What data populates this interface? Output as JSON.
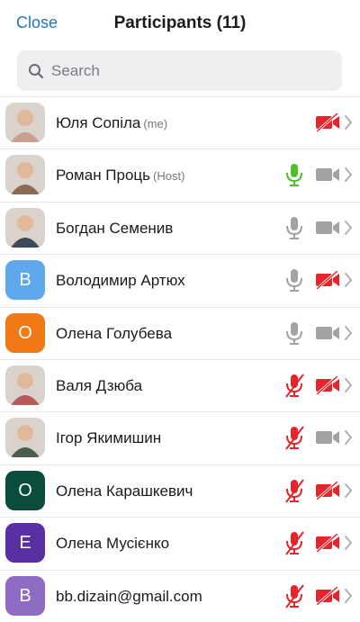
{
  "header": {
    "close_label": "Close",
    "title": "Participants (11)"
  },
  "search": {
    "placeholder": "Search"
  },
  "participants": [
    {
      "name": "Юля Сопіла",
      "tag": "(me)",
      "avatar_type": "photo",
      "avatar_color": "#c9a090",
      "mic": "none",
      "video": "off"
    },
    {
      "name": "Роман Проць",
      "tag": "(Host)",
      "avatar_type": "photo",
      "avatar_color": "#8b6b52",
      "mic": "active",
      "video": "on"
    },
    {
      "name": "Богдан Семенив",
      "tag": "",
      "avatar_type": "photo",
      "avatar_color": "#3d4a5c",
      "mic": "on",
      "video": "on"
    },
    {
      "name": "Володимир Артюх",
      "tag": "",
      "avatar_type": "letter",
      "letter": "В",
      "avatar_color": "#5fa8ee",
      "mic": "on",
      "video": "off"
    },
    {
      "name": "Олена Голубева",
      "tag": "",
      "avatar_type": "letter",
      "letter": "О",
      "avatar_color": "#ef7a16",
      "mic": "on",
      "video": "on"
    },
    {
      "name": "Валя Дзюба",
      "tag": "",
      "avatar_type": "photo",
      "avatar_color": "#b65a5a",
      "mic": "muted",
      "video": "off"
    },
    {
      "name": "Ігор Якимишин",
      "tag": "",
      "avatar_type": "photo",
      "avatar_color": "#4a5b4f",
      "mic": "muted",
      "video": "on"
    },
    {
      "name": "Олена Карашкевич",
      "tag": "",
      "avatar_type": "letter",
      "letter": "О",
      "avatar_color": "#0a4d3c",
      "mic": "muted",
      "video": "off"
    },
    {
      "name": "Олена Мусієнко",
      "tag": "",
      "avatar_type": "letter",
      "letter": "Е",
      "avatar_color": "#5a2fa3",
      "mic": "muted",
      "video": "off"
    },
    {
      "name": "bb.dizain@gmail.com",
      "tag": "",
      "avatar_type": "letter",
      "letter": "B",
      "avatar_color": "#8e6cc4",
      "mic": "muted",
      "video": "off"
    }
  ],
  "icons": {
    "mic_on_color": "#a3a3a3",
    "mic_active_color": "#4fbf2c",
    "muted_color": "#e5242b",
    "video_on_color": "#a3a3a3",
    "video_off_color": "#e5242b",
    "chevron_color": "#b0b0b0",
    "search_icon": "magnifier-icon",
    "mic_icon": "microphone-icon",
    "video_icon": "video-camera-icon",
    "chevron_icon": "chevron-right-icon"
  }
}
